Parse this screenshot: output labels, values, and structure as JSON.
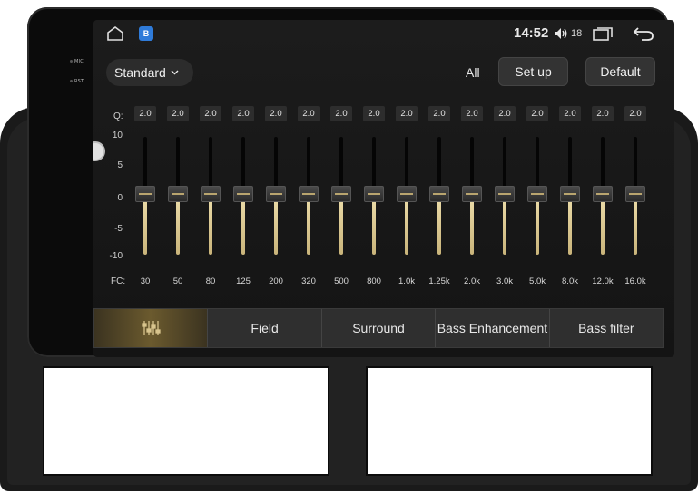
{
  "status": {
    "time": "14:52",
    "volume": "18",
    "app_badge": "B"
  },
  "hardware": {
    "mic": "MIC",
    "rst": "RST"
  },
  "toolbar": {
    "preset": "Standard",
    "all_label": "All",
    "setup_label": "Set up",
    "default_label": "Default"
  },
  "eq": {
    "q_label": "Q:",
    "fc_label": "FC:",
    "scale": [
      "10",
      "5",
      "0",
      "-5",
      "-10"
    ],
    "bands": [
      {
        "q": "2.0",
        "fc": "30",
        "gain": 0
      },
      {
        "q": "2.0",
        "fc": "50",
        "gain": 0
      },
      {
        "q": "2.0",
        "fc": "80",
        "gain": 0
      },
      {
        "q": "2.0",
        "fc": "125",
        "gain": 0
      },
      {
        "q": "2.0",
        "fc": "200",
        "gain": 0
      },
      {
        "q": "2.0",
        "fc": "320",
        "gain": 0
      },
      {
        "q": "2.0",
        "fc": "500",
        "gain": 0
      },
      {
        "q": "2.0",
        "fc": "800",
        "gain": 0
      },
      {
        "q": "2.0",
        "fc": "1.0k",
        "gain": 0
      },
      {
        "q": "2.0",
        "fc": "1.25k",
        "gain": 0
      },
      {
        "q": "2.0",
        "fc": "2.0k",
        "gain": 0
      },
      {
        "q": "2.0",
        "fc": "3.0k",
        "gain": 0
      },
      {
        "q": "2.0",
        "fc": "5.0k",
        "gain": 0
      },
      {
        "q": "2.0",
        "fc": "8.0k",
        "gain": 0
      },
      {
        "q": "2.0",
        "fc": "12.0k",
        "gain": 0
      },
      {
        "q": "2.0",
        "fc": "16.0k",
        "gain": 0
      }
    ]
  },
  "tabs": [
    {
      "label": "",
      "icon": "equalizer-icon",
      "active": true
    },
    {
      "label": "Field",
      "active": false
    },
    {
      "label": "Surround",
      "active": false
    },
    {
      "label": "Bass Enhancement",
      "active": false
    },
    {
      "label": "Bass filter",
      "active": false
    }
  ],
  "colors": {
    "accent": "#c9b47a",
    "screen_bg": "#181818",
    "frame": "#1a1a1a"
  }
}
